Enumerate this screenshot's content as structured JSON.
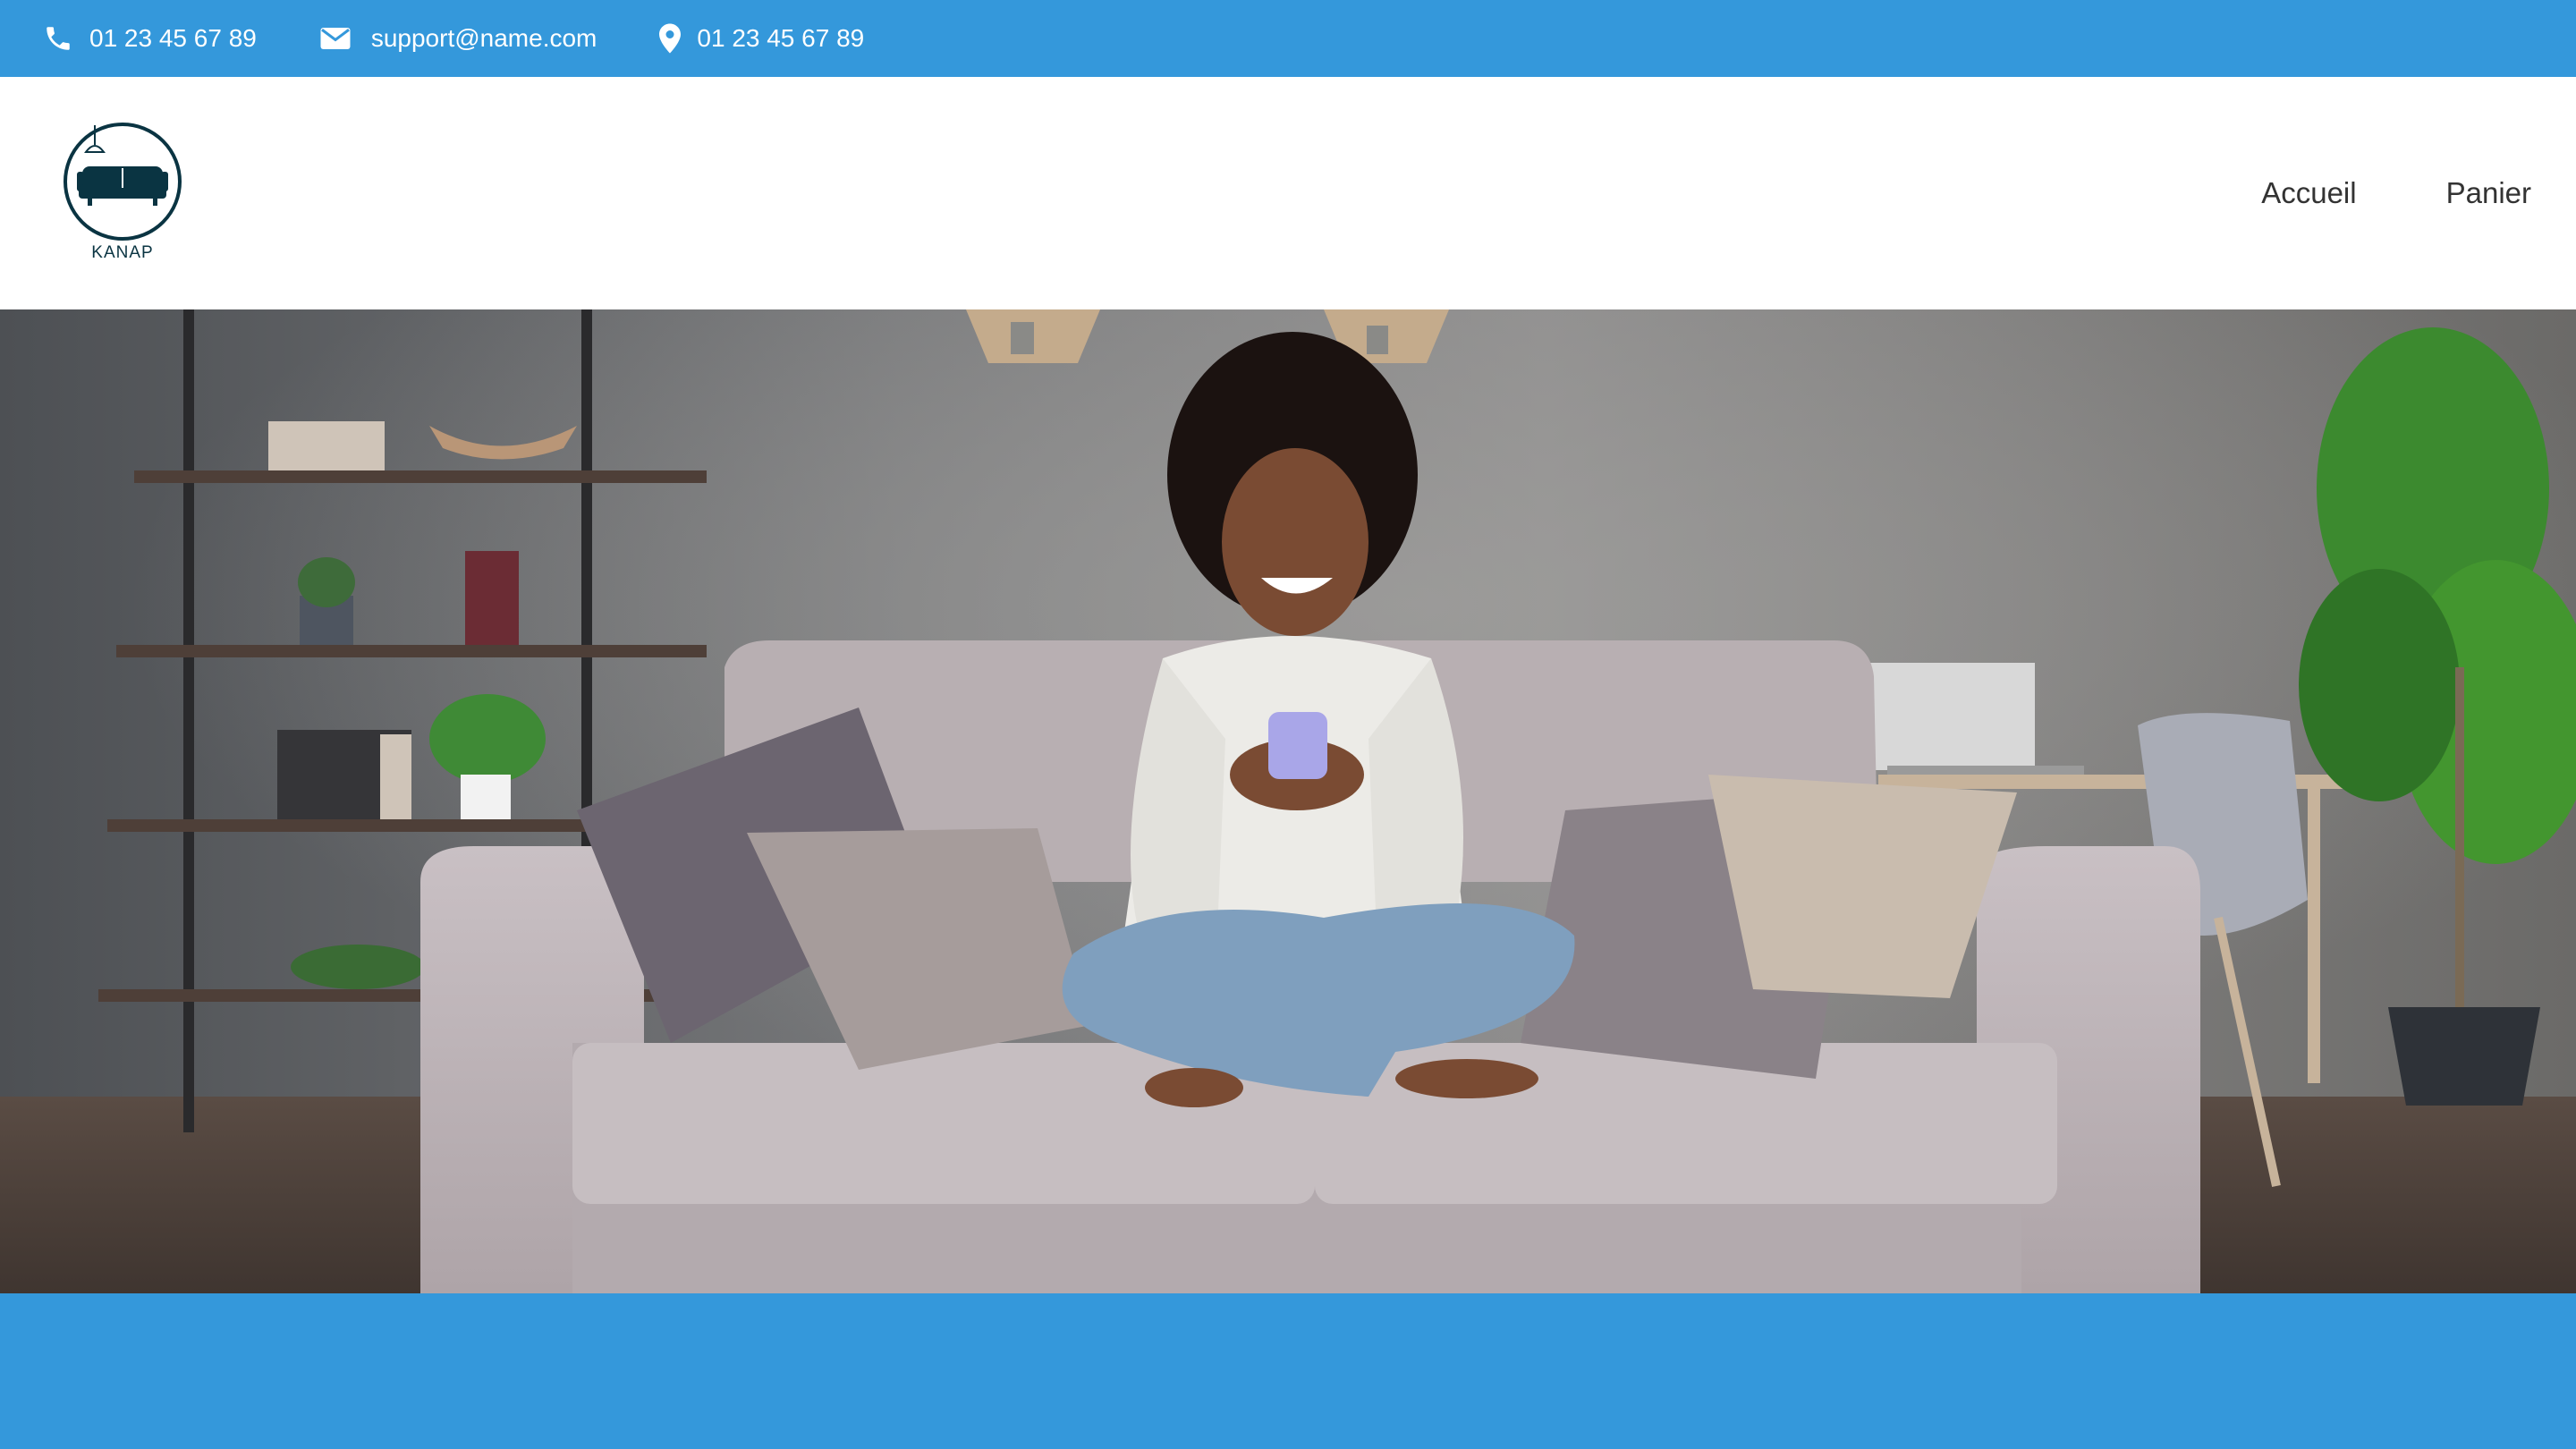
{
  "topbar": {
    "phone": {
      "icon": "phone-icon",
      "text": "01 23 45 67 89"
    },
    "email": {
      "icon": "mail-icon",
      "text": "support@name.com"
    },
    "location": {
      "icon": "location-pin-icon",
      "text": "01 23 45 67 89"
    }
  },
  "header": {
    "logo": {
      "icon": "sofa-logo-icon",
      "text": "KANAP"
    },
    "nav": [
      {
        "label": "Accueil"
      },
      {
        "label": "Panier"
      }
    ]
  },
  "hero": {
    "image": "woman-on-sofa-with-phone-banner"
  },
  "colors": {
    "accent": "#3498db",
    "header_bg": "#ffffff",
    "logo": "#0a3442",
    "nav_text": "#333333"
  }
}
